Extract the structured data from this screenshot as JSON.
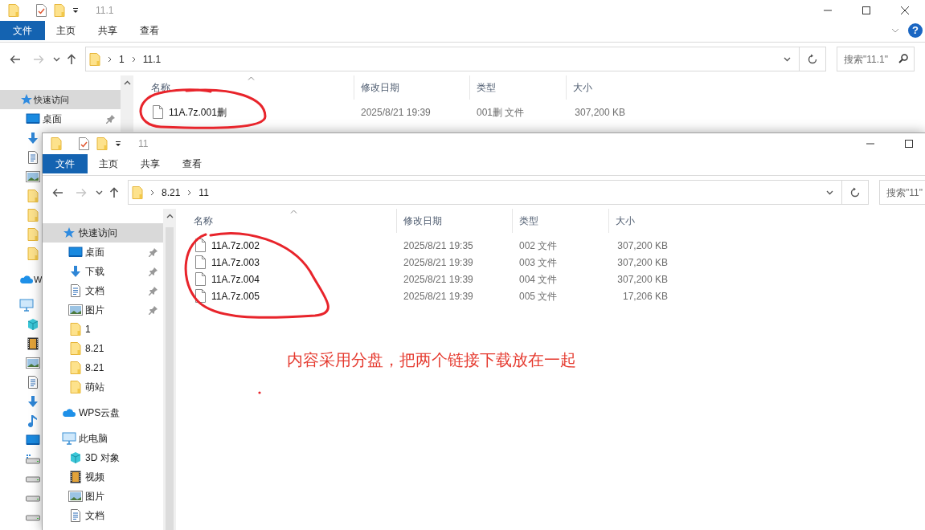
{
  "windows": [
    {
      "title": "11.1",
      "controls": [
        {
          "kind": "minimize"
        },
        {
          "kind": "maximize"
        },
        {
          "kind": "close"
        }
      ],
      "ribbon_tabs": [
        {
          "label": "文件",
          "selected": true
        },
        {
          "label": "主页",
          "selected": false
        },
        {
          "label": "共享",
          "selected": false
        },
        {
          "label": "查看",
          "selected": false
        }
      ],
      "ribbon_toggle": true,
      "help_button": "?",
      "breadcrumb": [
        "1",
        "11.1"
      ],
      "search": {
        "placeholder": "搜索\"11.1\"",
        "icon": true
      },
      "sidebar": [
        {
          "kind": "star",
          "label": "快速访问",
          "selected": true,
          "children": [
            {
              "kind": "desktop",
              "label": "桌面",
              "selected": false,
              "pinned": true
            },
            {
              "kind": "download",
              "selected": false
            },
            {
              "kind": "document",
              "selected": false
            },
            {
              "kind": "picture",
              "selected": false
            },
            {
              "kind": "folder",
              "selected": false
            },
            {
              "kind": "folder",
              "selected": false
            },
            {
              "kind": "folder",
              "selected": false
            },
            {
              "kind": "folder",
              "selected": false
            }
          ]
        },
        {
          "kind": "cloud",
          "label": "W",
          "selected": false
        },
        {
          "kind": "computer",
          "selected": false,
          "children": [
            {
              "kind": "cube",
              "selected": false
            },
            {
              "kind": "video",
              "selected": false
            },
            {
              "kind": "picture",
              "selected": false
            },
            {
              "kind": "document",
              "selected": false
            },
            {
              "kind": "download",
              "selected": false
            },
            {
              "kind": "music",
              "selected": false
            },
            {
              "kind": "desktop",
              "selected": false
            },
            {
              "kind": "system_drive",
              "selected": false
            },
            {
              "kind": "drive",
              "selected": false
            },
            {
              "kind": "drive",
              "selected": false
            },
            {
              "kind": "drive",
              "selected": false
            }
          ]
        }
      ],
      "columns": [
        "名称",
        "修改日期",
        "类型",
        "大小"
      ],
      "files": [
        {
          "name": "11A.7z.001删",
          "date": "2025/8/21 19:39",
          "type": "001删 文件",
          "size": "307,200 KB"
        }
      ]
    },
    {
      "title": "11",
      "controls": [
        {
          "kind": "minimize"
        },
        {
          "kind": "maximize"
        }
      ],
      "ribbon_tabs": [
        {
          "label": "文件",
          "selected": true
        },
        {
          "label": "主页",
          "selected": false
        },
        {
          "label": "共享",
          "selected": false
        },
        {
          "label": "查看",
          "selected": false
        }
      ],
      "ribbon_toggle": false,
      "breadcrumb": [
        "8.21",
        "11"
      ],
      "search": {
        "placeholder": "搜索\"11\""
      },
      "sidebar": [
        {
          "kind": "star",
          "label": "快速访问",
          "selected": true,
          "children": [
            {
              "kind": "desktop",
              "label": "桌面",
              "selected": false,
              "pinned": true
            },
            {
              "kind": "download",
              "label": "下载",
              "selected": false,
              "pinned": true
            },
            {
              "kind": "document",
              "label": "文档",
              "selected": false,
              "pinned": true
            },
            {
              "kind": "picture",
              "label": "图片",
              "selected": false,
              "pinned": true
            },
            {
              "kind": "folder",
              "label": "1",
              "selected": false,
              "pinned": false
            },
            {
              "kind": "folder",
              "label": "8.21",
              "selected": false,
              "pinned": false
            },
            {
              "kind": "folder",
              "label": "8.21",
              "selected": false,
              "pinned": false
            },
            {
              "kind": "folder",
              "label": "萌站",
              "selected": false,
              "pinned": false
            }
          ]
        },
        {
          "kind": "cloud",
          "label": "WPS云盘",
          "selected": false
        },
        {
          "kind": "computer",
          "label": "此电脑",
          "selected": false,
          "children": [
            {
              "kind": "cube",
              "label": "3D 对象",
              "selected": false
            },
            {
              "kind": "video",
              "label": "视频",
              "selected": false
            },
            {
              "kind": "picture",
              "label": "图片",
              "selected": false
            },
            {
              "kind": "document",
              "label": "文档",
              "selected": false
            }
          ]
        }
      ],
      "columns": [
        "名称",
        "修改日期",
        "类型",
        "大小"
      ],
      "files": [
        {
          "name": "11A.7z.002",
          "date": "2025/8/21 19:35",
          "type": "002 文件",
          "size": "307,200 KB"
        },
        {
          "name": "11A.7z.003",
          "date": "2025/8/21 19:39",
          "type": "003 文件",
          "size": "307,200 KB"
        },
        {
          "name": "11A.7z.004",
          "date": "2025/8/21 19:39",
          "type": "004 文件",
          "size": "307,200 KB"
        },
        {
          "name": "11A.7z.005",
          "date": "2025/8/21 19:39",
          "type": "005 文件",
          "size": "17,206 KB"
        }
      ]
    }
  ],
  "annotation": "内容采用分盘，把两个链接下载放在一起"
}
